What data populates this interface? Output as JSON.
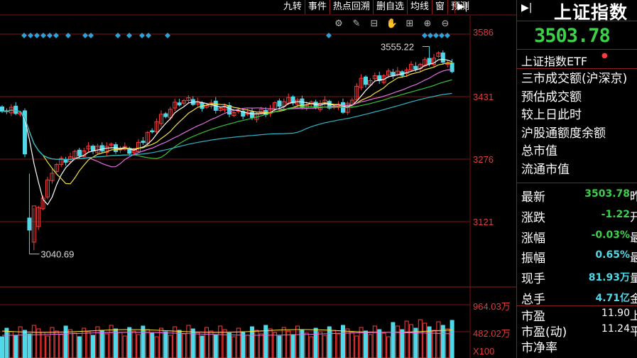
{
  "toolbar": {
    "items": [
      "九转",
      "事件",
      "热点回溯",
      "删自选",
      "均线",
      "窗",
      "预测"
    ],
    "collapse_arrow": "▶|"
  },
  "chart_icons": [
    "gear-icon",
    "pen-icon",
    "lock-icon",
    "hand-icon",
    "grid-icon",
    "zoom-in-icon",
    "zoom-out-icon"
  ],
  "chart_labels": {
    "high_marker": "3555.22",
    "low_marker": "3040.69",
    "volume_unit": "X100"
  },
  "chart_data": {
    "type": "candlestick",
    "y_ticks": [
      "3586",
      "3431",
      "3276",
      "3121"
    ],
    "volume_ticks": [
      "964.03万",
      "482.02万"
    ],
    "ylim": [
      3000,
      3620
    ],
    "high": 3555.22,
    "low": 3040.69,
    "colors": {
      "up": "#ff3b3b",
      "down": "#4fd8e8",
      "ma5": "#ffffff",
      "ma10": "#f2e43c",
      "ma20": "#e070e0",
      "ma30": "#38c238",
      "ma60": "#2fb4c8"
    }
  },
  "right_panel": {
    "title": "上证指数",
    "price": "3503.78",
    "etf_label": "上证指数ETF",
    "info_rows": [
      "三市成交额(沪深京)",
      "预估成交额",
      "较上日此时",
      "沪股通额度余额",
      "总市值",
      "流通市值"
    ],
    "stats": [
      {
        "label": "最新",
        "value": "3503.78",
        "color": "#3bd14a",
        "extra": "昨"
      },
      {
        "label": "涨跌",
        "value": "-1.22",
        "color": "#3bd14a",
        "extra": "开"
      },
      {
        "label": "涨幅",
        "value": "-0.03%",
        "color": "#3bd14a",
        "extra": "最"
      },
      {
        "label": "振幅",
        "value": "0.65%",
        "color": "#4fd8e8",
        "extra": "最"
      },
      {
        "label": "现手",
        "value": "81.93万",
        "color": "#4fd8e8",
        "extra": "量"
      },
      {
        "label": "总手",
        "value": "4.71亿",
        "color": "#4fd8e8",
        "extra": "金"
      }
    ],
    "pe": [
      {
        "label": "市盈",
        "value": "11.90",
        "extra": "上"
      },
      {
        "label": "市盈(动)",
        "value": "11.24",
        "extra": "平"
      },
      {
        "label": "市净率",
        "value": "",
        "extra": ""
      }
    ]
  }
}
